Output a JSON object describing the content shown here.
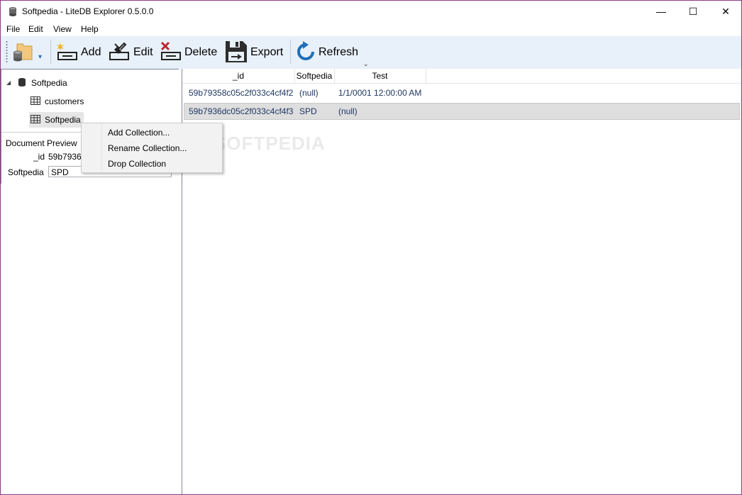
{
  "window": {
    "title": "Softpedia - LiteDB Explorer 0.5.0.0",
    "minimize": "—",
    "maximize": "☐",
    "close": "✕"
  },
  "menubar": {
    "items": [
      "File",
      "Edit",
      "View",
      "Help"
    ]
  },
  "toolbar": {
    "open_icon": "database-folder-icon",
    "dropdown": "▾",
    "add_label": "Add",
    "edit_label": "Edit",
    "delete_label": "Delete",
    "export_label": "Export",
    "refresh_label": "Refresh",
    "overflow": "⌄"
  },
  "tree": {
    "expander": "◢",
    "database": "Softpedia",
    "collections": [
      "customers",
      "Softpedia"
    ]
  },
  "preview": {
    "title": "Document Preview",
    "id_label": "_id",
    "id_value": "59b7936",
    "field_label": "Softpedia",
    "field_value": "SPD"
  },
  "grid": {
    "columns": [
      "_id",
      "Softpedia",
      "Test"
    ],
    "rows": [
      {
        "id": "59b79358c05c2f033c4cf4f2",
        "softpedia": "(null)",
        "test": "1/1/0001 12:00:00 AM"
      },
      {
        "id": "59b7936dc05c2f033c4cf4f3",
        "softpedia": "SPD",
        "test": "(null)"
      }
    ]
  },
  "context_menu": {
    "items": [
      "Add Collection...",
      "Rename Collection...",
      "Drop Collection"
    ]
  },
  "watermark": "SOFTPEDIA",
  "colors": {
    "toolbar_bg": "#e8f0f9",
    "window_border": "#8e3a8e",
    "grid_text": "#1f3763",
    "icon_blue": "#1e6fb8",
    "icon_red": "#c0272d"
  }
}
